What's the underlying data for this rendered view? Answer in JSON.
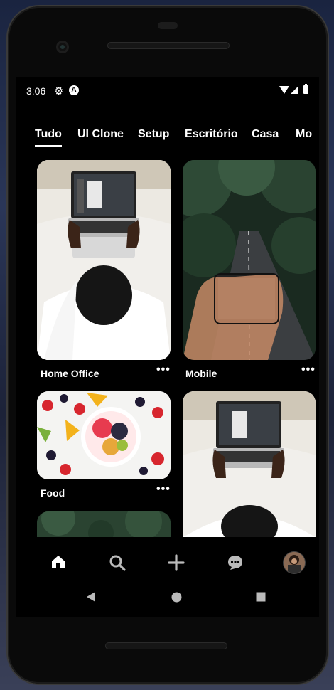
{
  "status": {
    "time": "3:06"
  },
  "tabs": [
    {
      "label": "Tudo",
      "active": true
    },
    {
      "label": "UI Clone"
    },
    {
      "label": "Setup"
    },
    {
      "label": "Escritório"
    },
    {
      "label": "Casa"
    },
    {
      "label": "Mo"
    }
  ],
  "pins": [
    {
      "title": "Home Office",
      "more": "•••"
    },
    {
      "title": "Mobile",
      "more": "•••"
    },
    {
      "title": "Food",
      "more": "•••"
    }
  ],
  "nav": {
    "items": [
      "home-icon",
      "search-icon",
      "add-icon",
      "chat-icon",
      "profile-avatar"
    ]
  },
  "colors": {
    "background": "#000000",
    "text": "#ffffff"
  }
}
